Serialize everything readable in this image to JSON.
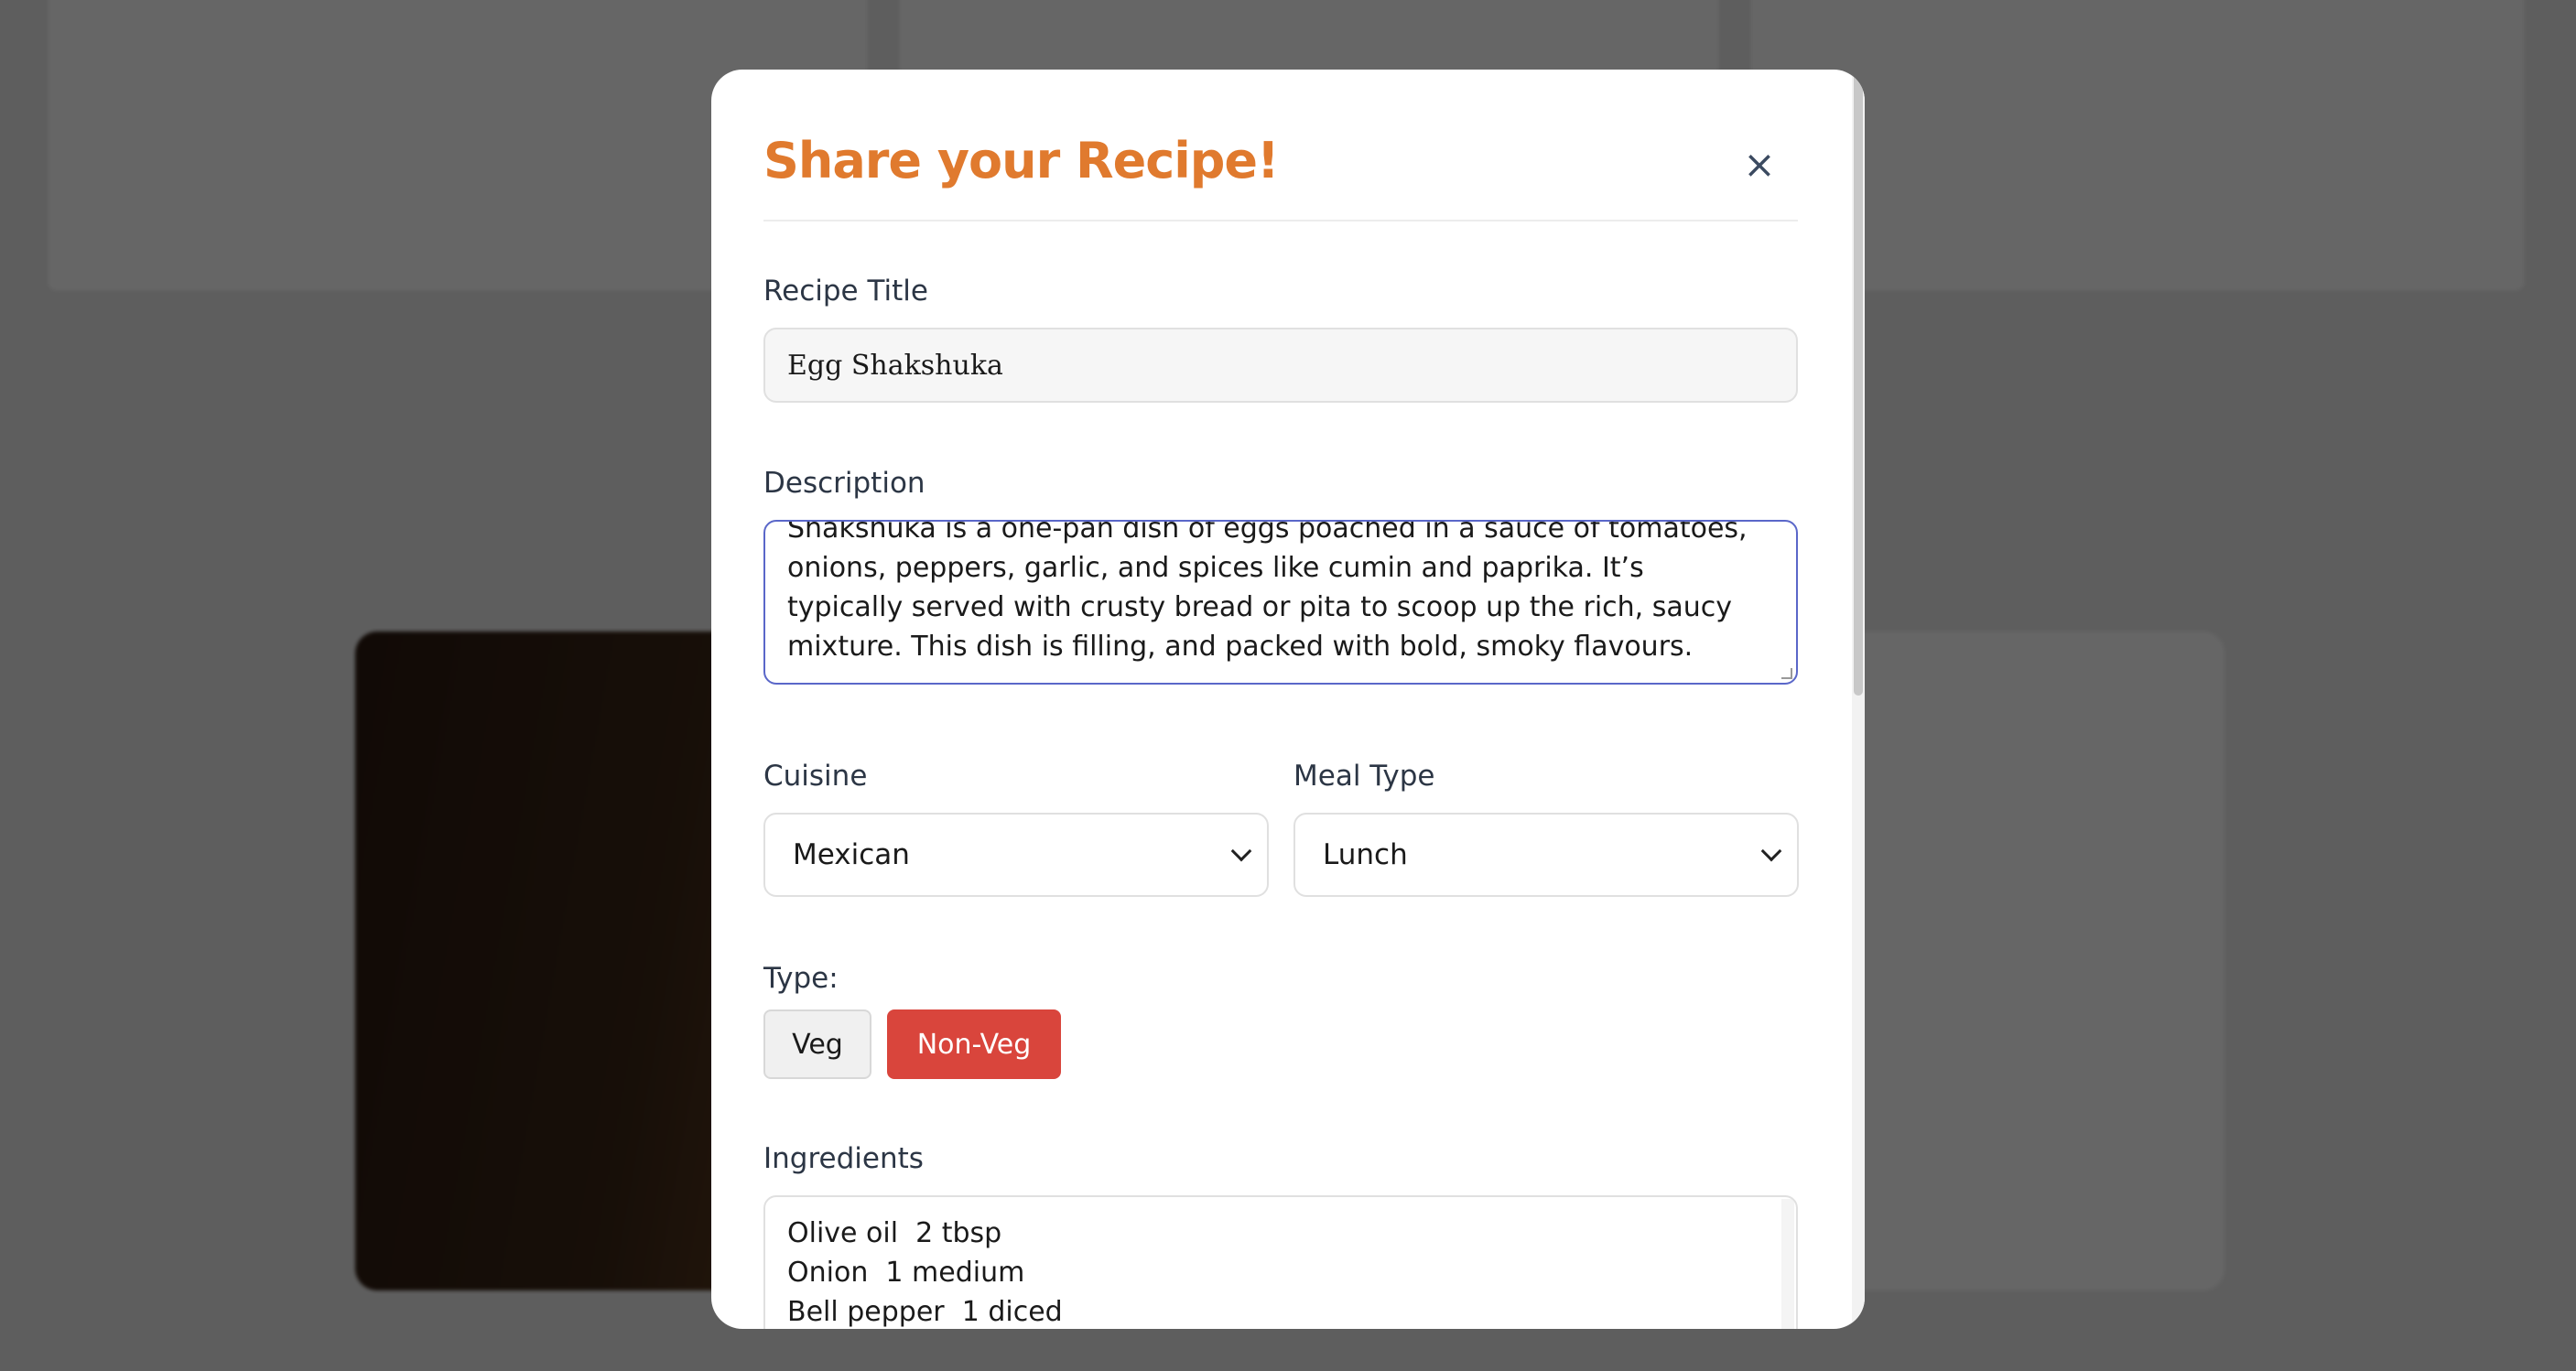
{
  "modal": {
    "title": "Share your Recipe!",
    "close_label": "×"
  },
  "form": {
    "title_label": "Recipe Title",
    "title_value": "Egg Shakshuka",
    "description_label": "Description",
    "description_value": "Shakshuka is a one-pan dish of eggs poached in a sauce of tomatoes, onions, peppers, garlic, and spices like cumin and paprika. It’s typically served with crusty bread or pita to scoop up the rich, saucy mixture. This dish is filling, and packed with bold, smoky flavours.",
    "cuisine_label": "Cuisine",
    "cuisine_value": "Mexican",
    "meal_type_label": "Meal Type",
    "meal_type_value": "Lunch",
    "type_label": "Type:",
    "type_options": {
      "veg": "Veg",
      "non_veg": "Non-Veg"
    },
    "type_selected": "Non-Veg",
    "ingredients_label": "Ingredients",
    "ingredients_value": "Olive oil  2 tbsp\nOnion  1 medium\nBell pepper  1 diced"
  },
  "colors": {
    "accent": "#e07a2e",
    "selected_type": "#d9453c",
    "focus_border": "#5a67c9"
  },
  "icons": {
    "close": "close-icon",
    "select_arrow": "chevron-down-icon"
  }
}
